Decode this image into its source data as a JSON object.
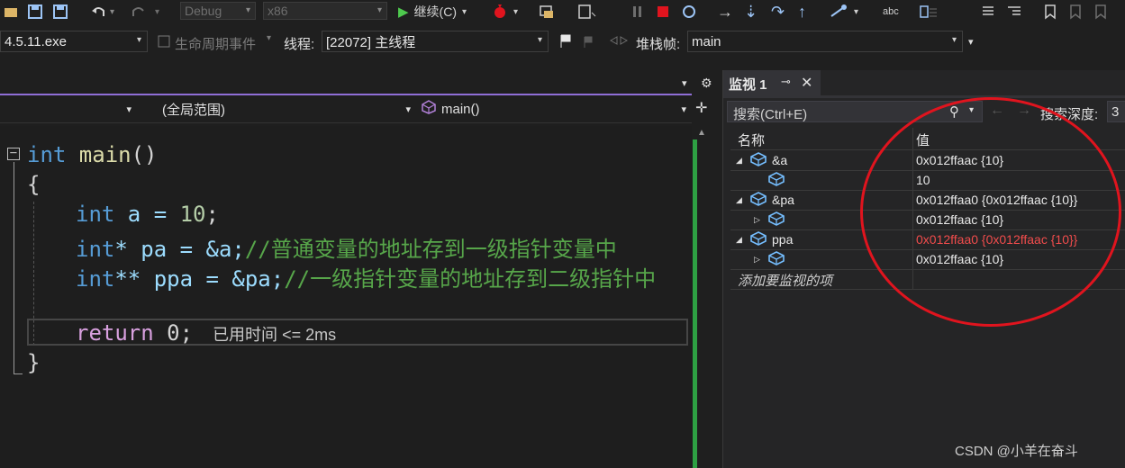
{
  "toolbar1": {
    "config_value": "Debug",
    "platform_value": "x86",
    "continue_label": "继续(C)"
  },
  "toolbar2": {
    "process_value": "4.5.11.exe",
    "lifecycle_label": "生命周期事件",
    "thread_label": "线程:",
    "thread_value": "[22072] 主线程",
    "stackframe_label": "堆栈帧:",
    "stackframe_value": "main"
  },
  "editor": {
    "scope_value": "(全局范围)",
    "function_value": "main()",
    "code_lines": [
      {
        "kw": "int",
        "fn": " main",
        "rest": "()"
      },
      {
        "text": "{"
      },
      {
        "kw": "int",
        "rest": " a = ",
        "num": "10",
        "end": ";"
      },
      {
        "kw": "int",
        "rest": "* pa = &a;",
        "comment": "//普通变量的地址存到一级指针变量中"
      },
      {
        "kw": "int",
        "rest": "** ppa = &pa;",
        "comment": "//一级指针变量的地址存到二级指针中"
      },
      {
        "ret": "return",
        "rest": " 0;",
        "hint": "已用时间 <= 2ms"
      },
      {
        "text": "}"
      }
    ]
  },
  "watch": {
    "tab_label": "监视 1",
    "search_placeholder": "搜索(Ctrl+E)",
    "search_depth_label": "搜索深度:",
    "search_depth_value": "3",
    "col_name": "名称",
    "col_value": "值",
    "rows": [
      {
        "name": "&a",
        "value": "0x012ffaac {10}",
        "expander": "◢",
        "changed": false
      },
      {
        "name": "",
        "value": "10",
        "expander": "",
        "changed": false
      },
      {
        "name": "&pa",
        "value": "0x012ffaa0 {0x012ffaac {10}}",
        "expander": "◢",
        "changed": false
      },
      {
        "name": "",
        "value": "0x012ffaac {10}",
        "expander": "▷",
        "changed": false
      },
      {
        "name": "ppa",
        "value": "0x012ffaa0 {0x012ffaac {10}}",
        "expander": "◢",
        "changed": true
      },
      {
        "name": "",
        "value": "0x012ffaac {10}",
        "expander": "▷",
        "changed": false
      }
    ],
    "add_item_label": "添加要监视的项",
    "changed_color": "#f14c4c"
  },
  "watermark": "CSDN @小羊在奋斗"
}
